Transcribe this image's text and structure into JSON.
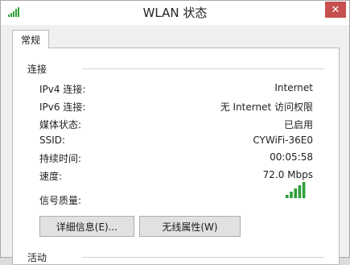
{
  "window": {
    "title": "WLAN 状态",
    "close_glyph": "✕"
  },
  "tabs": [
    {
      "label": "常规"
    }
  ],
  "connection": {
    "section_label": "连接",
    "rows": [
      {
        "label": "IPv4 连接:",
        "value": "Internet"
      },
      {
        "label": "IPv6 连接:",
        "value": "无 Internet 访问权限"
      },
      {
        "label": "媒体状态:",
        "value": "已启用"
      },
      {
        "label": "SSID:",
        "value": "CYWiFi-36E0"
      },
      {
        "label": "持续时间:",
        "value": "00:05:58"
      },
      {
        "label": "速度:",
        "value": "72.0 Mbps"
      }
    ],
    "signal_label": "信号质量:",
    "signal_bars_total": 5,
    "signal_bars_filled": 5
  },
  "buttons": {
    "details": "详细信息(E)...",
    "wireless_properties": "无线属性(W)"
  },
  "activity": {
    "section_label": "活动"
  },
  "colors": {
    "signal_green": "#2f9e3a",
    "close_red": "#c74f4f"
  }
}
